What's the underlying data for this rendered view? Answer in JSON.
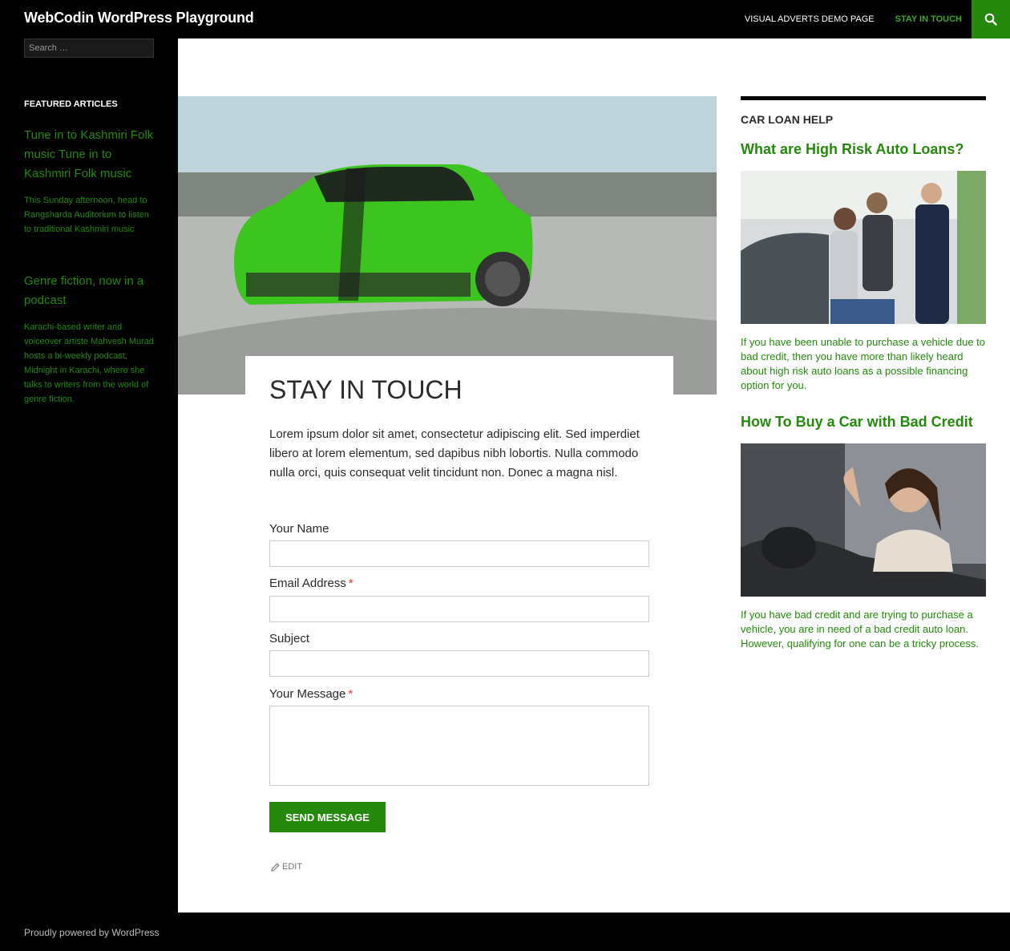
{
  "header": {
    "site_title": "WebCodin WordPress Playground",
    "nav": [
      "VISUAL ADVERTS DEMO PAGE",
      "STAY IN TOUCH"
    ],
    "accent": "#24890d"
  },
  "sidebar": {
    "search_placeholder": "Search …",
    "widget_title": "FEATURED ARTICLES",
    "articles": [
      {
        "title": "Tune in to Kashmiri Folk music Tune in to Kashmiri Folk music",
        "excerpt": "This Sunday afternoon, head to Rangsharda Auditorium to listen to traditional Kashmiri music"
      },
      {
        "title": "Genre fiction, now in a podcast",
        "excerpt": "Karachi-based writer and voiceover artiste Mahvesh Murad hosts a bi-weekly podcast, Midnight in Karachi, where she talks to writers from the world of genre fiction."
      }
    ]
  },
  "main": {
    "title": "STAY IN TOUCH",
    "intro": "Lorem ipsum dolor sit amet, consectetur adipiscing elit. Sed imperdiet libero at lorem elementum, sed dapibus nibh lobortis. Nulla commodo nulla orci, quis consequat velit tincidunt non. Donec a magna nisl.",
    "form": {
      "name_label": "Your Name",
      "email_label": "Email Address",
      "subject_label": "Subject",
      "message_label": "Your Message",
      "required_mark": "*",
      "send_label": "SEND MESSAGE"
    },
    "edit_label": "EDIT"
  },
  "right_sidebar": {
    "widget_title": "CAR LOAN HELP",
    "posts": [
      {
        "title": "What are High Risk Auto Loans?",
        "excerpt": "If you have been unable to purchase a vehicle due to bad credit, then you have more than likely heard about high risk auto loans as a possible financing option for you."
      },
      {
        "title": "How To Buy a Car with Bad Credit",
        "excerpt": "If you have bad credit and are trying to purchase a vehicle, you are in need of a bad credit auto loan. However, qualifying for one can be a tricky process."
      }
    ]
  },
  "footer": {
    "text": "Proudly powered by WordPress"
  }
}
